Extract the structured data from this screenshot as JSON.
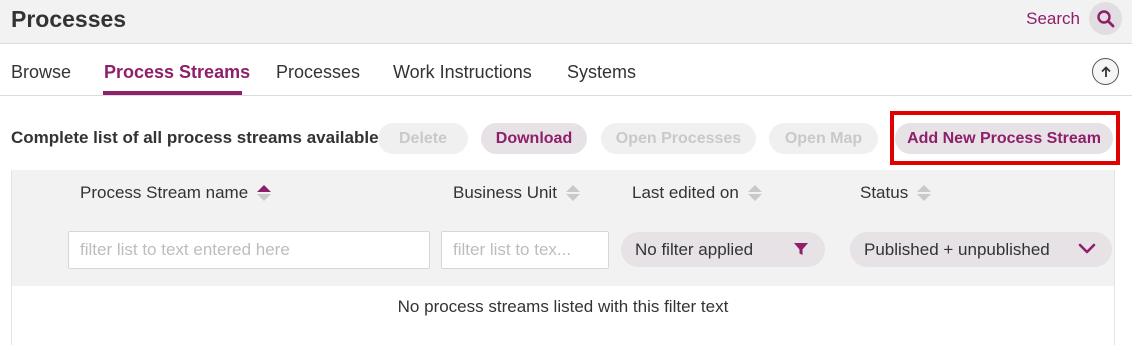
{
  "header": {
    "title": "Processes",
    "search_label": "Search",
    "search_icon": "search-icon"
  },
  "tabs": [
    {
      "label": "Browse",
      "active": false
    },
    {
      "label": "Process Streams",
      "active": true
    },
    {
      "label": "Processes",
      "active": false
    },
    {
      "label": "Work Instructions",
      "active": false
    },
    {
      "label": "Systems",
      "active": false
    }
  ],
  "toolbar": {
    "description": "Complete list of all process streams available ...",
    "buttons": [
      {
        "label": "Delete",
        "enabled": false
      },
      {
        "label": "Download",
        "enabled": true
      },
      {
        "label": "Open Processes",
        "enabled": false
      },
      {
        "label": "Open Map",
        "enabled": false
      },
      {
        "label": "Add New Process Stream",
        "enabled": true,
        "highlighted": true
      }
    ]
  },
  "table": {
    "columns": [
      {
        "label": "Process Stream name",
        "sort": "ascending"
      },
      {
        "label": "Business Unit",
        "sort": "none"
      },
      {
        "label": "Last edited on",
        "sort": "none"
      },
      {
        "label": "Status",
        "sort": "none"
      }
    ],
    "filters": {
      "name_placeholder": "filter list to text entered here",
      "business_unit_placeholder": "filter list to tex...",
      "last_edited_value": "No filter applied",
      "status_value": "Published + unpublished"
    },
    "empty_message": "No process streams listed with this filter text"
  },
  "colors": {
    "accent": "#8e1f6b",
    "highlight": "#e00000",
    "header_bg": "#f2f2f2",
    "pill_bg": "#e6e2e5"
  }
}
